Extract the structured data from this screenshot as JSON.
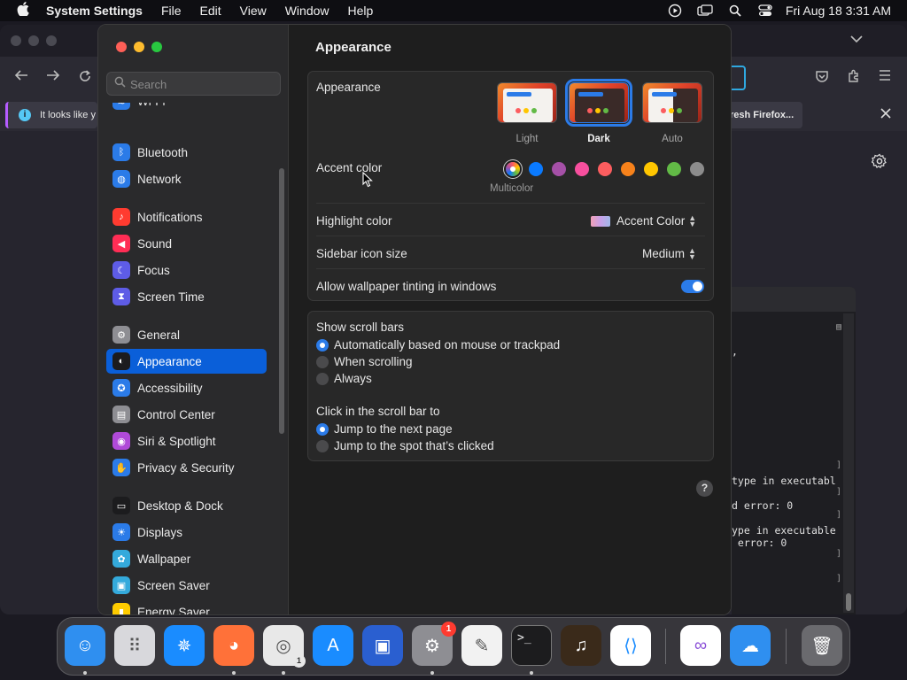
{
  "menubar": {
    "app_name": "System Settings",
    "menus": [
      "File",
      "Edit",
      "View",
      "Window",
      "Help"
    ],
    "clock": "Fri Aug 18  3:31 AM"
  },
  "browser": {
    "notice_text": "It looks like y",
    "refresh_text": "resh Firefox..."
  },
  "terminal": {
    "lines": [
      "type in executabl",
      "d error: 0",
      "ype in executable",
      " error: 0"
    ]
  },
  "search": {
    "placeholder": "Search"
  },
  "sidebar": {
    "items": [
      {
        "label": "Wi-Fi",
        "icon": "wifi-icon",
        "color": "#2b7be8"
      },
      {
        "label": "Bluetooth",
        "icon": "bluetooth-icon",
        "color": "#2b7be8"
      },
      {
        "label": "Network",
        "icon": "globe-icon",
        "color": "#2b7be8"
      },
      {
        "label": "Notifications",
        "icon": "bell-icon",
        "color": "#ff3b30"
      },
      {
        "label": "Sound",
        "icon": "speaker-icon",
        "color": "#ff2d55"
      },
      {
        "label": "Focus",
        "icon": "moon-icon",
        "color": "#5e5ce6"
      },
      {
        "label": "Screen Time",
        "icon": "hourglass-icon",
        "color": "#5e5ce6"
      },
      {
        "label": "General",
        "icon": "gear-icon",
        "color": "#8e8e93"
      },
      {
        "label": "Appearance",
        "icon": "appearance-icon",
        "color": "#1c1c1e"
      },
      {
        "label": "Accessibility",
        "icon": "accessibility-icon",
        "color": "#2b7be8"
      },
      {
        "label": "Control Center",
        "icon": "control-center-icon",
        "color": "#8e8e93"
      },
      {
        "label": "Siri & Spotlight",
        "icon": "siri-icon",
        "color": "#b04ad8"
      },
      {
        "label": "Privacy & Security",
        "icon": "hand-icon",
        "color": "#2b7be8"
      },
      {
        "label": "Desktop & Dock",
        "icon": "dock-icon",
        "color": "#1c1c1e"
      },
      {
        "label": "Displays",
        "icon": "sun-icon",
        "color": "#2b7be8"
      },
      {
        "label": "Wallpaper",
        "icon": "flower-icon",
        "color": "#34aadc"
      },
      {
        "label": "Screen Saver",
        "icon": "screensaver-icon",
        "color": "#34aadc"
      },
      {
        "label": "Energy Saver",
        "icon": "battery-icon",
        "color": "#ffcc00"
      }
    ],
    "selected": "Appearance"
  },
  "content": {
    "title": "Appearance",
    "appearance_label": "Appearance",
    "themes": [
      {
        "label": "Light",
        "selected": false
      },
      {
        "label": "Dark",
        "selected": true
      },
      {
        "label": "Auto",
        "selected": false
      }
    ],
    "accent_label": "Accent color",
    "accent_colors": [
      "#d65cc8",
      "#0a7aff",
      "#a550a7",
      "#f74f9e",
      "#fc5d5f",
      "#f7821b",
      "#ffc600",
      "#62ba46",
      "#8c8c8c"
    ],
    "accent_selected_name": "Multicolor",
    "highlight_label": "Highlight color",
    "highlight_value": "Accent Color",
    "sidebar_icon_label": "Sidebar icon size",
    "sidebar_icon_value": "Medium",
    "tinting_label": "Allow wallpaper tinting in windows",
    "tinting_on": true,
    "scroll_bars_label": "Show scroll bars",
    "scroll_options": [
      "Automatically based on mouse or trackpad",
      "When scrolling",
      "Always"
    ],
    "click_label": "Click in the scroll bar to",
    "click_options": [
      "Jump to the next page",
      "Jump to the spot that’s clicked"
    ],
    "help": "?"
  },
  "dock": {
    "apps": [
      {
        "name": "Finder",
        "icon": "finder-icon",
        "color": "#2f8ff0"
      },
      {
        "name": "Launchpad",
        "icon": "launchpad-icon",
        "color": "#d8d8dc"
      },
      {
        "name": "Safari",
        "icon": "safari-icon",
        "color": "#1a8cff"
      },
      {
        "name": "Firefox",
        "icon": "firefox-icon",
        "color": "#ff7139"
      },
      {
        "name": "Chrome",
        "icon": "chrome-icon",
        "color": "#e8e8e8"
      },
      {
        "name": "App Store",
        "icon": "app-store-icon",
        "color": "#1a8cff"
      },
      {
        "name": "Utility",
        "icon": "square-spiral-icon",
        "color": "#2a5fd0"
      },
      {
        "name": "System Settings",
        "icon": "system-settings-icon",
        "color": "#8e8e93"
      },
      {
        "name": "TextEdit",
        "icon": "textedit-icon",
        "color": "#f2f2f2"
      },
      {
        "name": "Terminal",
        "icon": "terminal-icon",
        "color": "#1c1c1e"
      },
      {
        "name": "GarageBand",
        "icon": "guitar-icon",
        "color": "#3a2a1a"
      },
      {
        "name": "VS Code",
        "icon": "vscode-icon",
        "color": "#ffffff"
      },
      {
        "name": "Visual Studio",
        "icon": "visual-studio-icon",
        "color": "#ffffff"
      },
      {
        "name": "Weather",
        "icon": "weather-icon",
        "color": "#2f8ff0"
      },
      {
        "name": "Trash",
        "icon": "trash-icon",
        "color": "#6a6a6e"
      }
    ],
    "settings_badge": "1",
    "chrome_badge": "1",
    "terminal_prompt": ">_"
  }
}
